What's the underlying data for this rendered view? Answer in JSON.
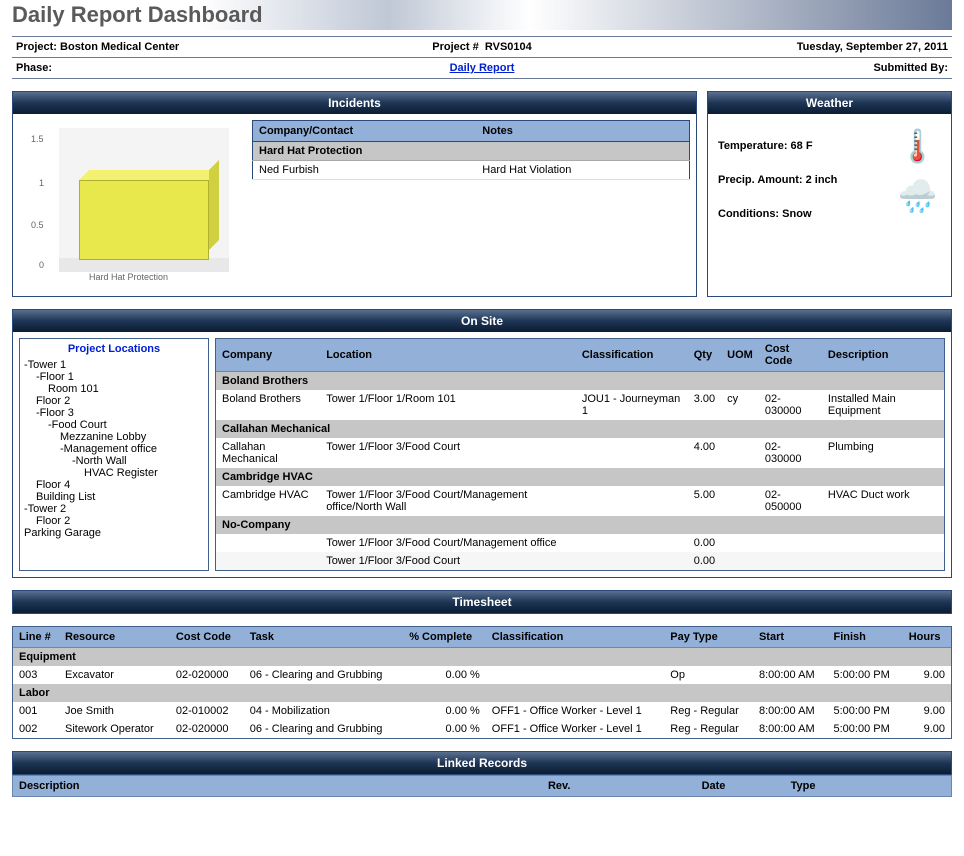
{
  "title": "Daily Report Dashboard",
  "header": {
    "project_label": "Project:",
    "project_value": "Boston Medical Center",
    "projectnum_label": "Project #",
    "projectnum_value": "RVS0104",
    "date": "Tuesday, September 27, 2011",
    "phase_label": "Phase:",
    "center_link": "Daily Report",
    "submitted_label": "Submitted By:"
  },
  "incidents": {
    "title": "Incidents",
    "columns": {
      "company": "Company/Contact",
      "notes": "Notes"
    },
    "group": "Hard Hat Protection",
    "rows": [
      {
        "company": "Ned Furbish",
        "notes": "Hard Hat Violation"
      }
    ],
    "chart_label": "Hard Hat Protection"
  },
  "chart_data": {
    "type": "bar",
    "categories": [
      "Hard Hat Protection"
    ],
    "values": [
      1
    ],
    "title": "",
    "xlabel": "",
    "ylabel": "",
    "ylim": [
      0,
      1.5
    ]
  },
  "weather": {
    "title": "Weather",
    "temp_label": "Temperature:",
    "temp_value": "68 F",
    "precip_label": "Precip. Amount:",
    "precip_value": "2 inch",
    "cond_label": "Conditions:",
    "cond_value": "Snow"
  },
  "onsite": {
    "title": "On Site",
    "tree_title": "Project Locations",
    "tree": [
      "-Tower 1",
      "  -Floor 1",
      "    Room 101",
      "  Floor 2",
      "  -Floor 3",
      "    -Food Court",
      "      Mezzanine Lobby",
      "      -Management office",
      "        -North Wall",
      "          HVAC Register",
      "  Floor 4",
      "  Building List",
      "-Tower 2",
      "  Floor 2",
      "Parking Garage"
    ],
    "columns": {
      "company": "Company",
      "location": "Location",
      "class": "Classification",
      "qty": "Qty",
      "uom": "UOM",
      "cost": "Cost Code",
      "desc": "Description"
    },
    "groups": [
      {
        "name": "Boland Brothers",
        "rows": [
          {
            "company": "Boland Brothers",
            "location": "Tower 1/Floor 1/Room 101",
            "class": "JOU1 - Journeyman 1",
            "qty": "3.00",
            "uom": "cy",
            "cost": "02-030000",
            "desc": "Installed Main Equipment"
          }
        ]
      },
      {
        "name": "Callahan Mechanical",
        "rows": [
          {
            "company": "Callahan Mechanical",
            "location": "Tower 1/Floor 3/Food Court",
            "class": "",
            "qty": "4.00",
            "uom": "",
            "cost": "02-030000",
            "desc": "Plumbing"
          }
        ]
      },
      {
        "name": "Cambridge HVAC",
        "rows": [
          {
            "company": "Cambridge HVAC",
            "location": "Tower 1/Floor 3/Food Court/Management office/North Wall",
            "class": "",
            "qty": "5.00",
            "uom": "",
            "cost": "02-050000",
            "desc": "HVAC Duct work"
          }
        ]
      },
      {
        "name": "No-Company",
        "rows": [
          {
            "company": "",
            "location": "Tower 1/Floor 3/Food Court/Management office",
            "class": "",
            "qty": "0.00",
            "uom": "",
            "cost": "",
            "desc": ""
          },
          {
            "company": "",
            "location": "Tower 1/Floor 3/Food Court",
            "class": "",
            "qty": "0.00",
            "uom": "",
            "cost": "",
            "desc": ""
          }
        ]
      }
    ]
  },
  "timesheet": {
    "title": "Timesheet",
    "columns": {
      "line": "Line #",
      "resource": "Resource",
      "cost": "Cost Code",
      "task": "Task",
      "pct": "% Complete",
      "class": "Classification",
      "pay": "Pay Type",
      "start": "Start",
      "finish": "Finish",
      "hours": "Hours"
    },
    "groups": [
      {
        "name": "Equipment",
        "rows": [
          {
            "line": "003",
            "resource": "Excavator",
            "cost": "02-020000",
            "task": "06 - Clearing and Grubbing",
            "pct": "0.00 %",
            "class": "",
            "pay": "Op",
            "start": "8:00:00 AM",
            "finish": "5:00:00 PM",
            "hours": "9.00"
          }
        ]
      },
      {
        "name": "Labor",
        "rows": [
          {
            "line": "001",
            "resource": "Joe Smith",
            "cost": "02-010002",
            "task": "04 - Mobilization",
            "pct": "0.00 %",
            "class": "OFF1 - Office Worker - Level 1",
            "pay": "Reg - Regular",
            "start": "8:00:00 AM",
            "finish": "5:00:00 PM",
            "hours": "9.00"
          },
          {
            "line": "002",
            "resource": "Sitework Operator",
            "cost": "02-020000",
            "task": "06 - Clearing and Grubbing",
            "pct": "0.00 %",
            "class": "OFF1 - Office Worker - Level 1",
            "pay": "Reg - Regular",
            "start": "8:00:00 AM",
            "finish": "5:00:00 PM",
            "hours": "9.00"
          }
        ]
      }
    ]
  },
  "linked": {
    "title": "Linked Records",
    "columns": {
      "desc": "Description",
      "rev": "Rev.",
      "date": "Date",
      "type": "Type"
    }
  }
}
